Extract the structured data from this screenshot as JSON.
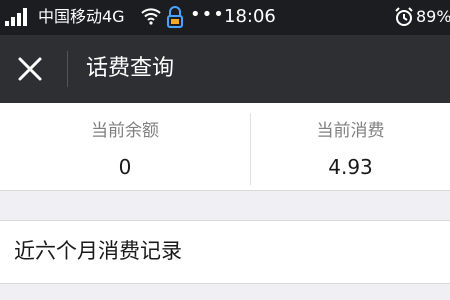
{
  "status_bar": {
    "carrier": "中国移动4G",
    "time": "18:06",
    "battery": "89%",
    "more": "•••",
    "icons": [
      "signal-icon",
      "wifi-icon",
      "vpn-lock-icon",
      "alarm-clock-icon"
    ]
  },
  "nav": {
    "title": "话费查询",
    "close_icon": "close-icon"
  },
  "balance": {
    "current_balance_label": "当前余额",
    "current_balance_value": "0",
    "current_spend_label": "当前消费",
    "current_spend_value": "4.93"
  },
  "history": {
    "label": "近六个月消费记录"
  }
}
